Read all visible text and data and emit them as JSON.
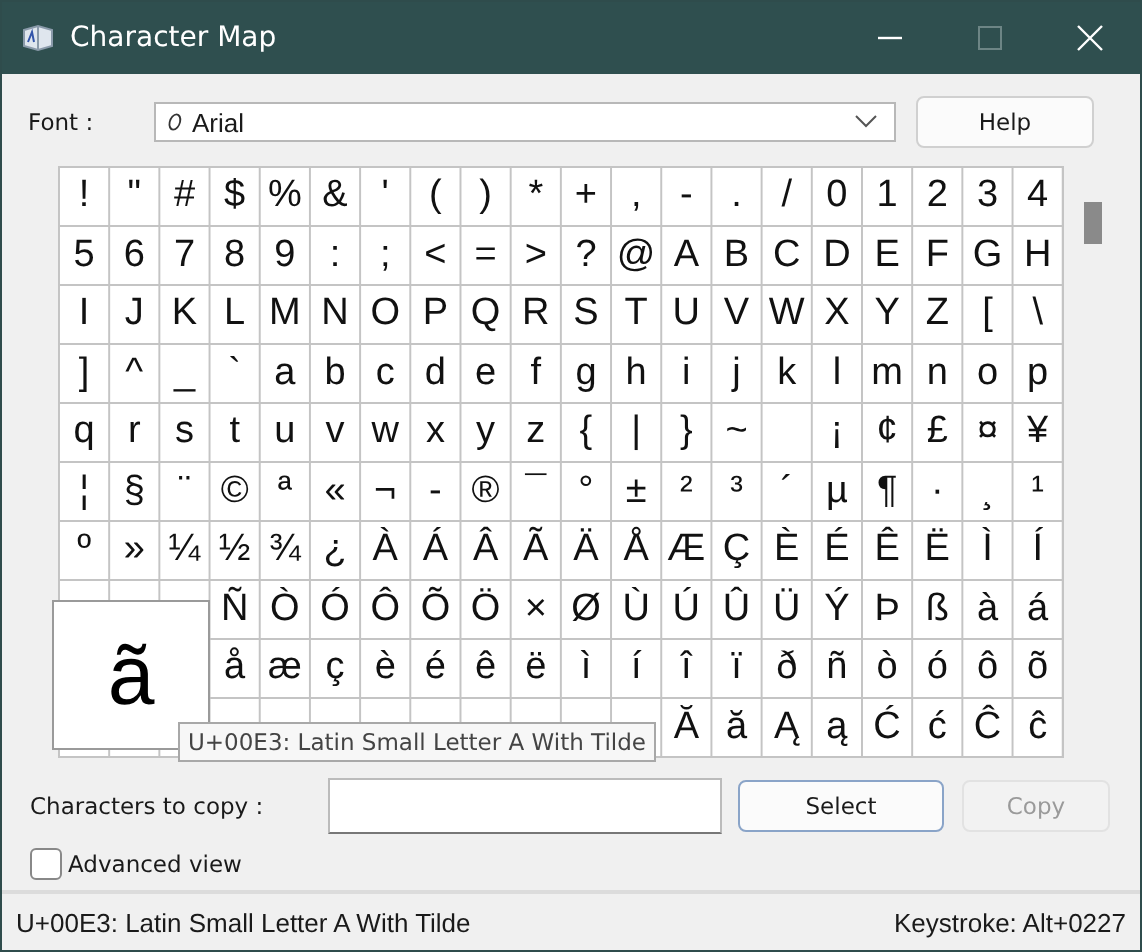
{
  "window": {
    "title": "Character Map"
  },
  "font": {
    "label": "Font :",
    "value": "Arial"
  },
  "help_button": "Help",
  "grid": {
    "rows": [
      [
        "!",
        "\"",
        "#",
        "$",
        "%",
        "&",
        "'",
        "(",
        ")",
        "*",
        "+",
        ",",
        "-",
        ".",
        "/",
        "0",
        "1",
        "2",
        "3",
        "4"
      ],
      [
        "5",
        "6",
        "7",
        "8",
        "9",
        ":",
        ";",
        "<",
        "=",
        ">",
        "?",
        "@",
        "A",
        "B",
        "C",
        "D",
        "E",
        "F",
        "G",
        "H"
      ],
      [
        "I",
        "J",
        "K",
        "L",
        "M",
        "N",
        "O",
        "P",
        "Q",
        "R",
        "S",
        "T",
        "U",
        "V",
        "W",
        "X",
        "Y",
        "Z",
        "[",
        "\\"
      ],
      [
        "]",
        "^",
        "_",
        "`",
        "a",
        "b",
        "c",
        "d",
        "e",
        "f",
        "g",
        "h",
        "i",
        "j",
        "k",
        "l",
        "m",
        "n",
        "o",
        "p"
      ],
      [
        "q",
        "r",
        "s",
        "t",
        "u",
        "v",
        "w",
        "x",
        "y",
        "z",
        "{",
        "|",
        "}",
        "~",
        null,
        "¡",
        "¢",
        "£",
        "¤",
        "¥"
      ],
      [
        "¦",
        "§",
        "¨",
        "©",
        "ª",
        "«",
        "¬",
        "-",
        "®",
        "¯",
        "°",
        "±",
        "²",
        "³",
        "´",
        "µ",
        "¶",
        "·",
        "¸",
        "¹"
      ],
      [
        "º",
        "»",
        "¼",
        "½",
        "¾",
        "¿",
        "À",
        "Á",
        "Â",
        "Ã",
        "Ä",
        "Å",
        "Æ",
        "Ç",
        "È",
        "É",
        "Ê",
        "Ë",
        "Ì",
        "Í"
      ],
      [
        null,
        null,
        null,
        "Ñ",
        "Ò",
        "Ó",
        "Ô",
        "Õ",
        "Ö",
        "×",
        "Ø",
        "Ù",
        "Ú",
        "Û",
        "Ü",
        "Ý",
        "Þ",
        "ß",
        "à",
        "á"
      ],
      [
        null,
        null,
        null,
        "å",
        "æ",
        "ç",
        "è",
        "é",
        "ê",
        "ë",
        "ì",
        "í",
        "î",
        "ï",
        "ð",
        "ñ",
        "ò",
        "ó",
        "ô",
        "õ"
      ],
      [
        null,
        null,
        null,
        null,
        null,
        null,
        null,
        null,
        null,
        null,
        null,
        null,
        "Ă",
        "ă",
        "Ą",
        "ą",
        "Ć",
        "ć",
        "Ĉ",
        "ĉ"
      ]
    ]
  },
  "magnifier": {
    "char": "ã"
  },
  "tooltip": "U+00E3: Latin Small Letter A With Tilde",
  "copy_field": {
    "label": "Characters to copy :"
  },
  "buttons": [
    {
      "label": "Select",
      "disabled": false
    },
    {
      "label": "Copy",
      "disabled": true
    }
  ],
  "advanced_view": {
    "label": "Advanced view",
    "checked": false
  },
  "status_bar": {
    "description": "U+00E3: Latin Small Letter A With Tilde",
    "keystroke": "Keystroke: Alt+0227"
  }
}
